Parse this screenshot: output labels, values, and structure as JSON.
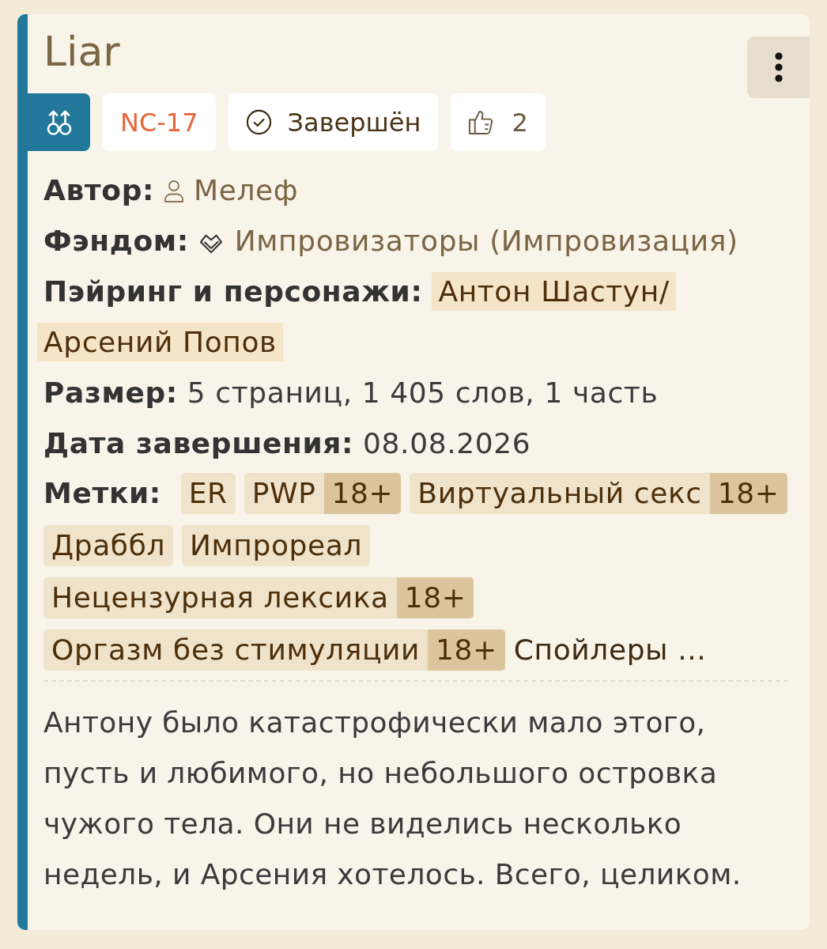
{
  "title": "Liar",
  "badges": [
    {
      "kind": "direction"
    },
    {
      "kind": "rating",
      "text": "NC-17"
    },
    {
      "kind": "status",
      "text": "Завершён"
    },
    {
      "kind": "likes",
      "text": "2"
    }
  ],
  "fields": [
    {
      "kind": "author",
      "label": "Автор:",
      "value": "Мелеф"
    },
    {
      "kind": "fandom",
      "label": "Фэндом:",
      "value": "Импровизаторы (Импровизация)"
    },
    {
      "kind": "pairing",
      "label": "Пэйринг и персонажи:",
      "value": "Антон Шастун/Арсений Попов"
    },
    {
      "kind": "text",
      "label": "Размер:",
      "value": "5 страниц, 1 405 слов, 1 часть"
    },
    {
      "kind": "text",
      "label": "Дата завершения:",
      "value": "08.08.2026"
    }
  ],
  "tags": {
    "label": "Метки:",
    "items": [
      {
        "text": "ER"
      },
      {
        "text": "PWP",
        "badge": "18+"
      },
      {
        "text": "Виртуальный секс",
        "badge": "18+"
      },
      {
        "text": "Драббл"
      },
      {
        "text": "Импрореал"
      },
      {
        "text": "Нецензурная лексика",
        "badge": "18+"
      },
      {
        "text": "Оргазм без стимуляции",
        "badge": "18+"
      }
    ],
    "more": "Спойлеры ..."
  },
  "description": "Антону было катастрофически мало этого, пусть и любимого, но небольшого островка чужого тела. Они не виделись несколько недель, и Арсения хотелось. Всего, целиком."
}
